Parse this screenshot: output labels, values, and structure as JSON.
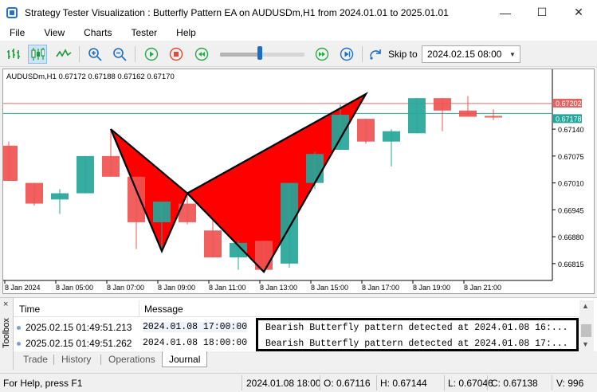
{
  "window": {
    "title": "Strategy Tester Visualization : Butterfly Pattern EA on AUDUSDm,H1 from 2024.01.01 to 2025.01.01",
    "minimize": "—",
    "maximize": "☐",
    "close": "✕"
  },
  "menu": [
    "File",
    "View",
    "Charts",
    "Tester",
    "Help"
  ],
  "toolbar": {
    "skip_label": "Skip to",
    "skip_date": "2024.02.15 08:00",
    "speed_level": 0.47,
    "icons": [
      "bar-chart-icon",
      "candlestick-chart-icon",
      "line-chart-icon",
      "zoom-in-icon",
      "zoom-out-icon",
      "play-icon",
      "stop-icon",
      "rewind-icon",
      "fast-forward-icon",
      "step-forward-icon",
      "skip-to-icon"
    ]
  },
  "chart": {
    "info": "AUDUSDm,H1  0.67172 0.67188 0.67162 0.67170",
    "price_tags": {
      "upper": "0.67202",
      "lower": "0.67178"
    },
    "colors": {
      "bull": "#26a69a",
      "bear": "#ef5350",
      "pattern_fill": "#ff0000",
      "upper_line": "#e06666",
      "lower_line": "#26a69a"
    }
  },
  "chart_data": {
    "type": "candlestick",
    "symbol": "AUDUSDm",
    "timeframe": "H1",
    "ylim": [
      0.6678,
      0.6725
    ],
    "y_ticks": [
      "0.67140",
      "0.67075",
      "0.67010",
      "0.66945",
      "0.66880",
      "0.66815"
    ],
    "x_ticks": [
      "8 Jan 2024",
      "8 Jan 05:00",
      "8 Jan 07:00",
      "8 Jan 09:00",
      "8 Jan 11:00",
      "8 Jan 13:00",
      "8 Jan 15:00",
      "8 Jan 17:00",
      "8 Jan 19:00",
      "8 Jan 21:00"
    ],
    "candles": [
      {
        "o": 0.671,
        "h": 0.6711,
        "l": 0.67015,
        "c": 0.67015
      },
      {
        "o": 0.6701,
        "h": 0.6701,
        "l": 0.66955,
        "c": 0.6696
      },
      {
        "o": 0.6697,
        "h": 0.66995,
        "l": 0.66935,
        "c": 0.66985
      },
      {
        "o": 0.66985,
        "h": 0.67075,
        "l": 0.66985,
        "c": 0.67075
      },
      {
        "o": 0.67075,
        "h": 0.6714,
        "l": 0.67025,
        "c": 0.67025
      },
      {
        "o": 0.67025,
        "h": 0.67025,
        "l": 0.6685,
        "c": 0.66915
      },
      {
        "o": 0.66915,
        "h": 0.66965,
        "l": 0.6685,
        "c": 0.66965
      },
      {
        "o": 0.6696,
        "h": 0.6698,
        "l": 0.6691,
        "c": 0.66915
      },
      {
        "o": 0.66895,
        "h": 0.6692,
        "l": 0.6683,
        "c": 0.6683
      },
      {
        "o": 0.6683,
        "h": 0.6687,
        "l": 0.668,
        "c": 0.66865
      },
      {
        "o": 0.6687,
        "h": 0.6687,
        "l": 0.668,
        "c": 0.668
      },
      {
        "o": 0.66815,
        "h": 0.6701,
        "l": 0.66805,
        "c": 0.6701
      },
      {
        "o": 0.6701,
        "h": 0.67085,
        "l": 0.66995,
        "c": 0.6708
      },
      {
        "o": 0.6709,
        "h": 0.672,
        "l": 0.6709,
        "c": 0.67175
      },
      {
        "o": 0.67165,
        "h": 0.67165,
        "l": 0.67105,
        "c": 0.6711
      },
      {
        "o": 0.6711,
        "h": 0.6714,
        "l": 0.6705,
        "c": 0.67135
      },
      {
        "o": 0.6713,
        "h": 0.67215,
        "l": 0.6713,
        "c": 0.67215
      },
      {
        "o": 0.67215,
        "h": 0.67215,
        "l": 0.67135,
        "c": 0.67185
      },
      {
        "o": 0.67185,
        "h": 0.6722,
        "l": 0.6717,
        "c": 0.6717
      },
      {
        "o": 0.67172,
        "h": 0.67188,
        "l": 0.67162,
        "c": 0.6717
      }
    ],
    "pattern": {
      "name": "Bearish Butterfly",
      "points": [
        {
          "candle": 4,
          "price": 0.6714
        },
        {
          "candle": 6,
          "price": 0.66845
        },
        {
          "candle": 7,
          "price": 0.66985
        },
        {
          "candle": 10,
          "price": 0.66795
        },
        {
          "candle": 14,
          "price": 0.67225
        }
      ]
    },
    "hlines": [
      0.67202,
      0.67178
    ]
  },
  "journal": {
    "col_time": "Time",
    "col_message": "Message",
    "rows": [
      {
        "time": "2025.02.15 01:49:51.213",
        "date": "2024.01.08 17:00:00",
        "message": "Bearish Butterfly pattern detected at 2024.01.08 16:..."
      },
      {
        "time": "2025.02.15 01:49:51.262",
        "date": "2024.01.08 18:00:00",
        "message": "Bearish Butterfly pattern detected at 2024.01.08 17:..."
      }
    ],
    "side_label": "Toolbox",
    "close": "×"
  },
  "tabs": [
    "Trade",
    "History",
    "Operations",
    "Journal"
  ],
  "status": {
    "help": "For Help, press F1",
    "datetime": "2024.01.08 18:00",
    "open": "O: 0.67116",
    "high": "H: 0.67144",
    "low": "L: 0.67046",
    "close": "C: 0.67138",
    "volume": "V: 996"
  }
}
